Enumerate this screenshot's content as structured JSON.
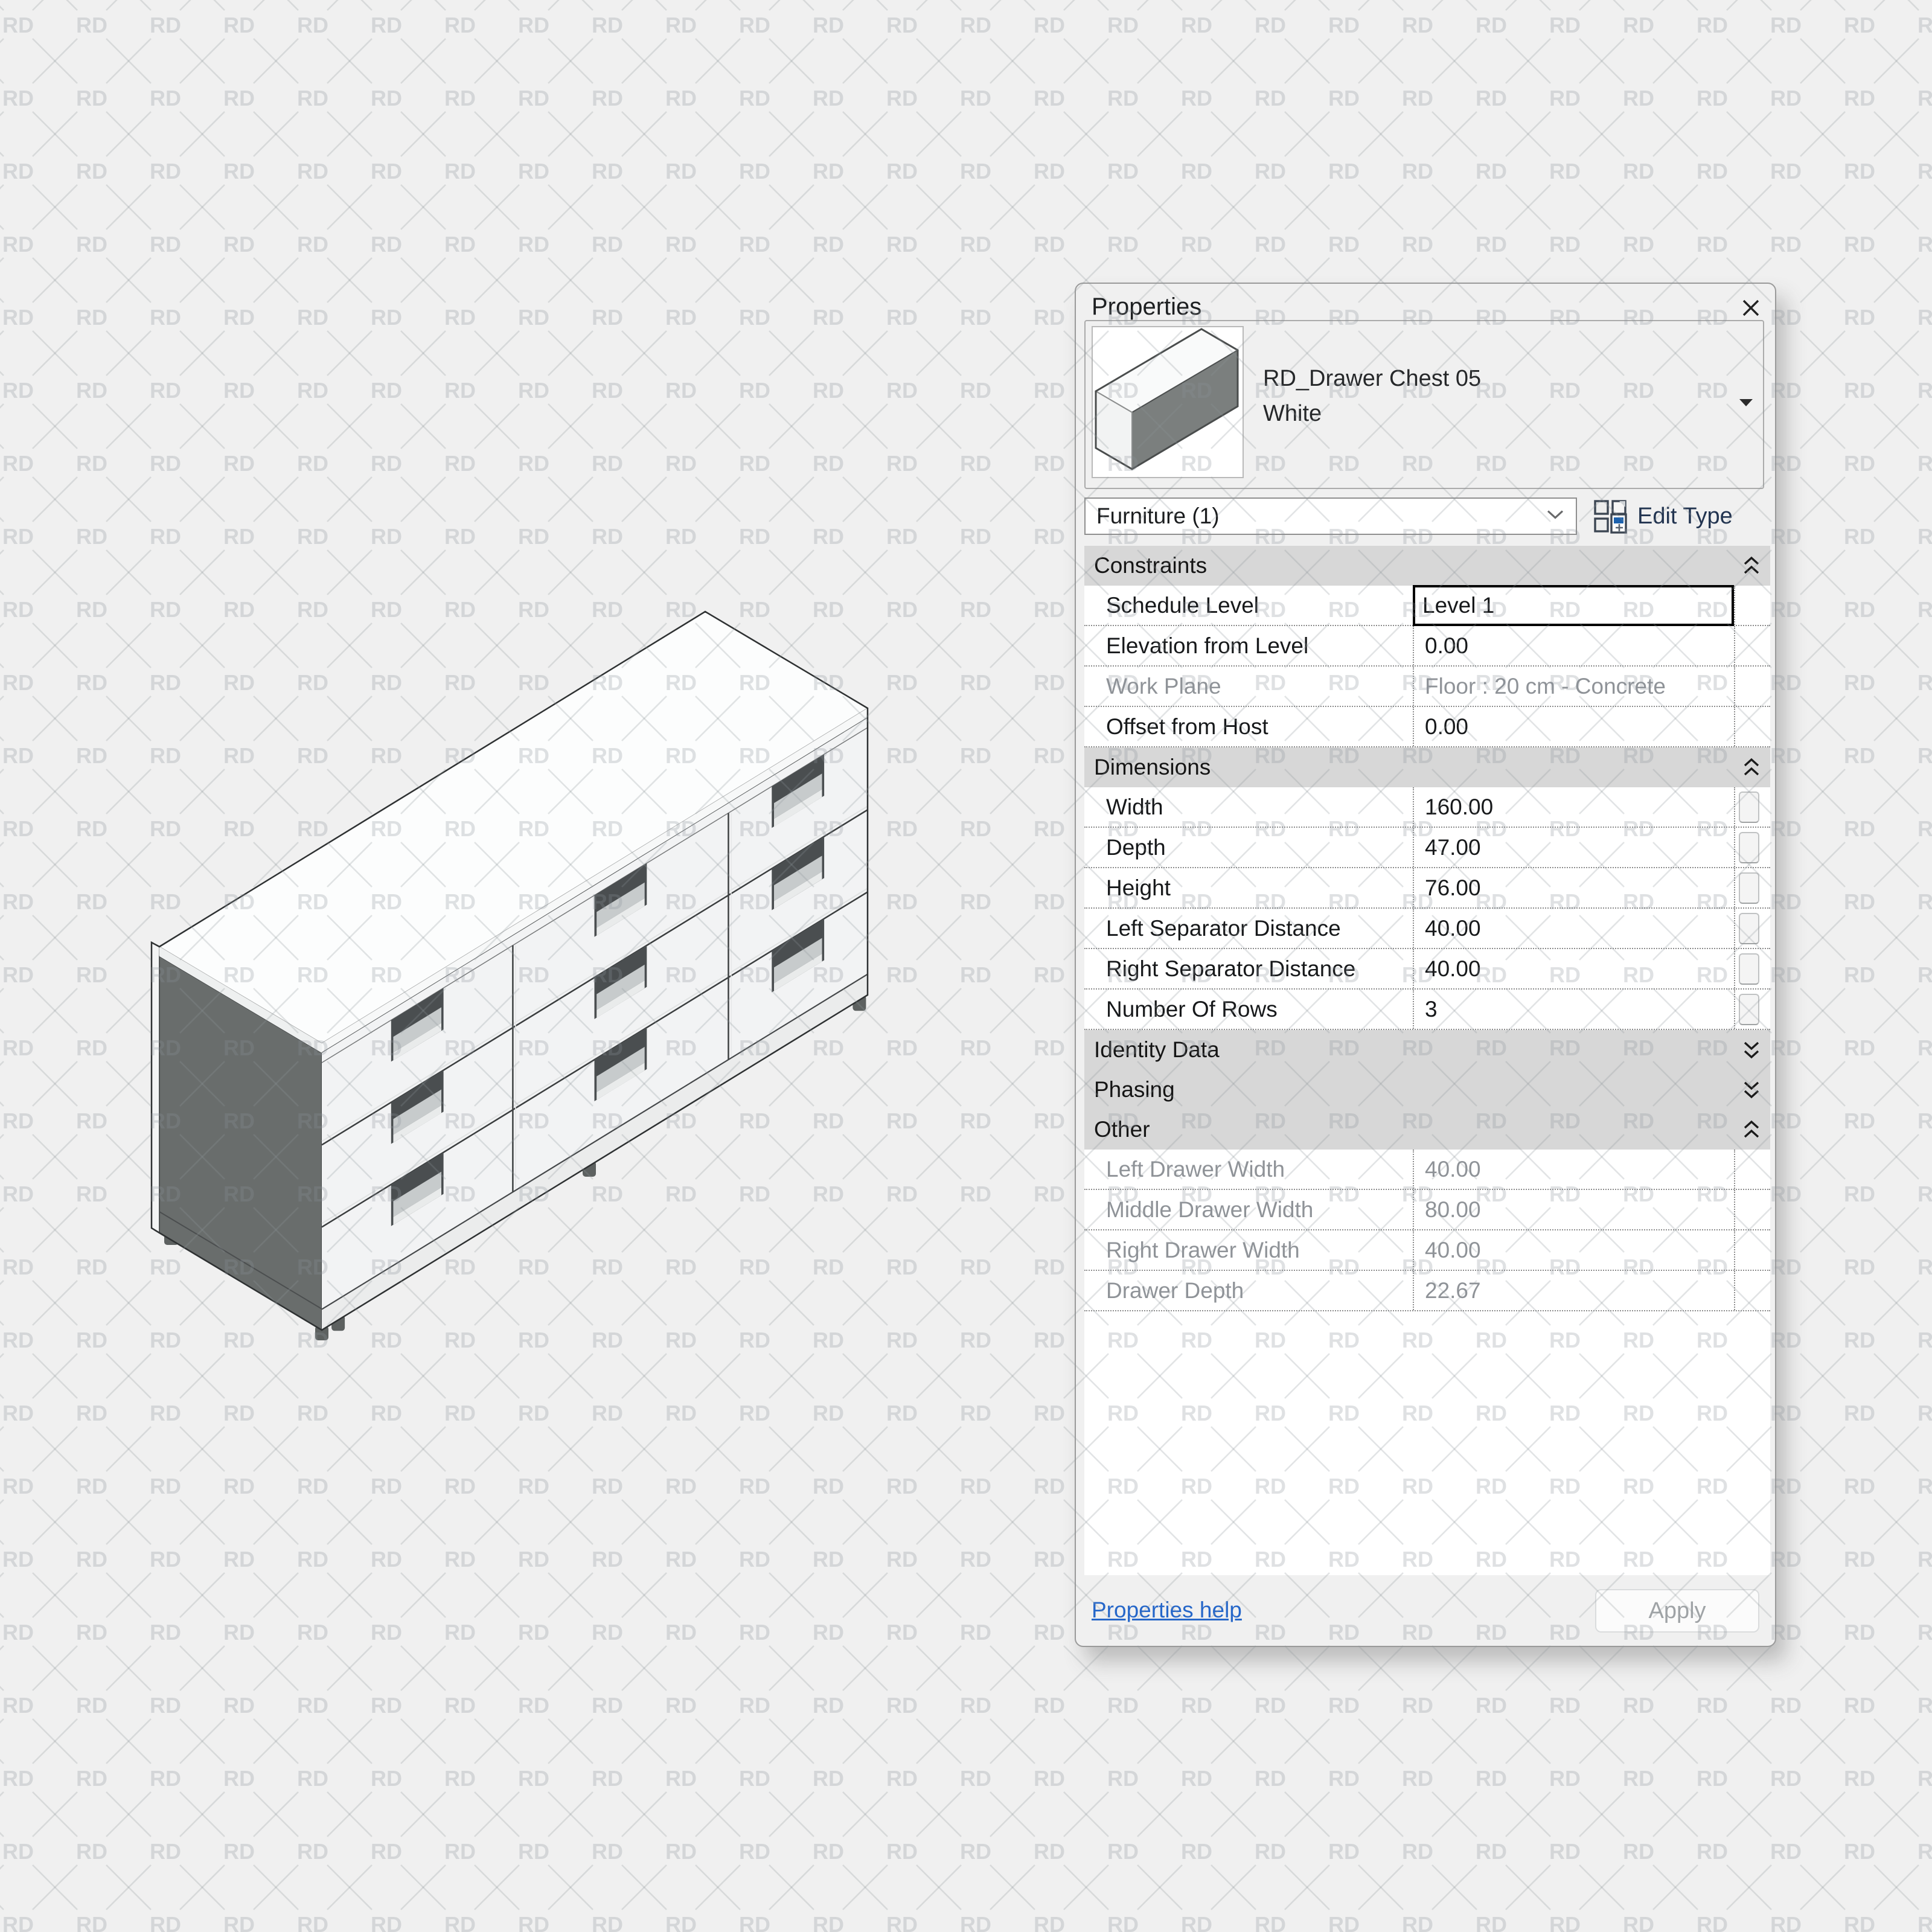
{
  "watermark": {
    "text": "RD"
  },
  "panel": {
    "title": "Properties",
    "type_selector": {
      "family": "RD_Drawer Chest 05",
      "type": "White"
    },
    "category": {
      "selected": "Furniture (1)"
    },
    "edit_type_label": "Edit Type",
    "sections": {
      "constraints": {
        "header": "Constraints",
        "rows": [
          {
            "label": "Schedule Level",
            "value": "Level 1",
            "state": "selected"
          },
          {
            "label": "Elevation from Level",
            "value": "0.00"
          },
          {
            "label": "Work Plane",
            "value": "Floor : 20 cm - Concrete",
            "state": "disabled"
          },
          {
            "label": "Offset from Host",
            "value": "0.00"
          }
        ]
      },
      "dimensions": {
        "header": "Dimensions",
        "rows": [
          {
            "label": "Width",
            "value": "160.00"
          },
          {
            "label": "Depth",
            "value": "47.00"
          },
          {
            "label": "Height",
            "value": "76.00"
          },
          {
            "label": "Left Separator Distance",
            "value": "40.00"
          },
          {
            "label": "Right Separator Distance",
            "value": "40.00"
          },
          {
            "label": "Number Of Rows",
            "value": "3"
          }
        ]
      },
      "identity": {
        "header": "Identity Data",
        "collapsed": true
      },
      "phasing": {
        "header": "Phasing",
        "collapsed": true
      },
      "other": {
        "header": "Other",
        "rows": [
          {
            "label": "Left Drawer Width",
            "value": "40.00",
            "state": "disabled"
          },
          {
            "label": "Middle Drawer Width",
            "value": "80.00",
            "state": "disabled"
          },
          {
            "label": "Right Drawer Width",
            "value": "40.00",
            "state": "disabled"
          },
          {
            "label": "Drawer Depth",
            "value": "22.67",
            "state": "disabled"
          }
        ]
      }
    },
    "footer": {
      "help_label": "Properties help",
      "apply_label": "Apply"
    }
  },
  "colors": {
    "page_bg": "#f0f0f0",
    "panel_bg": "#f0f0f0",
    "section_header_bg": "#d7d7d7",
    "selected_cell_border": "#000000",
    "disabled_text": "#8f9398",
    "link_blue": "#2667c9",
    "edit_type_icon_blue": "#1d62ae",
    "chest_side_dark": "#696d6c",
    "chest_front": "#f2f3f4",
    "chest_top": "#fcfdfd"
  }
}
